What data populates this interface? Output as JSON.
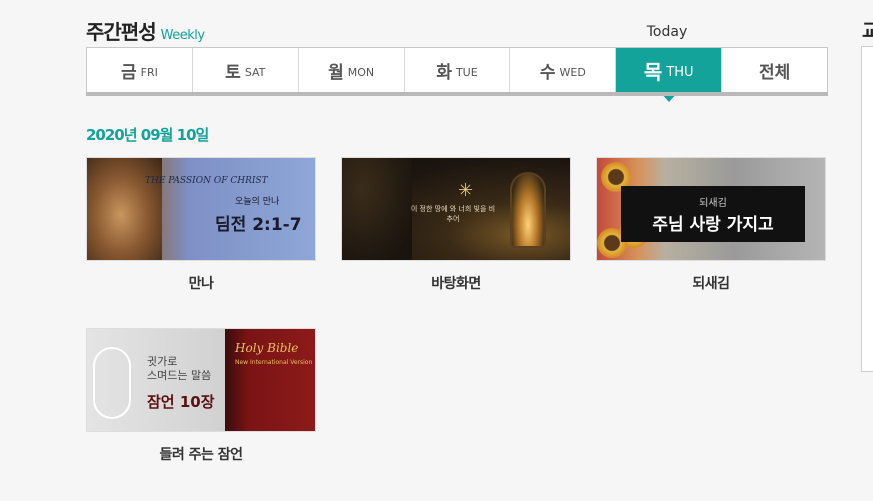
{
  "header": {
    "title": "주간편성",
    "subtitle": "Weekly"
  },
  "today_label": "Today",
  "day_tabs": [
    {
      "ko": "금",
      "en": "FRI"
    },
    {
      "ko": "토",
      "en": "SAT"
    },
    {
      "ko": "월",
      "en": "MON"
    },
    {
      "ko": "화",
      "en": "TUE"
    },
    {
      "ko": "수",
      "en": "WED"
    },
    {
      "ko": "목",
      "en": "THU"
    },
    {
      "ko": "전체",
      "en": ""
    }
  ],
  "active_tab_index": 5,
  "date": "2020년 09월 10일",
  "items": [
    {
      "caption": "만나",
      "thumb_text": {
        "script": "THE PASSION OF CHRIST",
        "small": "오늘의 만나",
        "big": "딤전 2:1-7"
      }
    },
    {
      "caption": "바탕화면",
      "thumb_text": {
        "verse": "이 정한 땅에 와 너희 빛을 비추어"
      }
    },
    {
      "caption": "되새김",
      "thumb_text": {
        "small": "되새김",
        "big": "주님 사랑 가지고"
      }
    },
    {
      "caption": "들려 주는 잠언",
      "thumb_text": {
        "line1": "귓가로",
        "line2": "스며드는 말씀",
        "big": "잠언 10장",
        "book_title": "Holy Bible",
        "book_sub": "New International Version"
      }
    }
  ],
  "right_panel": {
    "label": "교"
  },
  "colors": {
    "accent": "#14a39b",
    "background": "#f6f6f6"
  }
}
